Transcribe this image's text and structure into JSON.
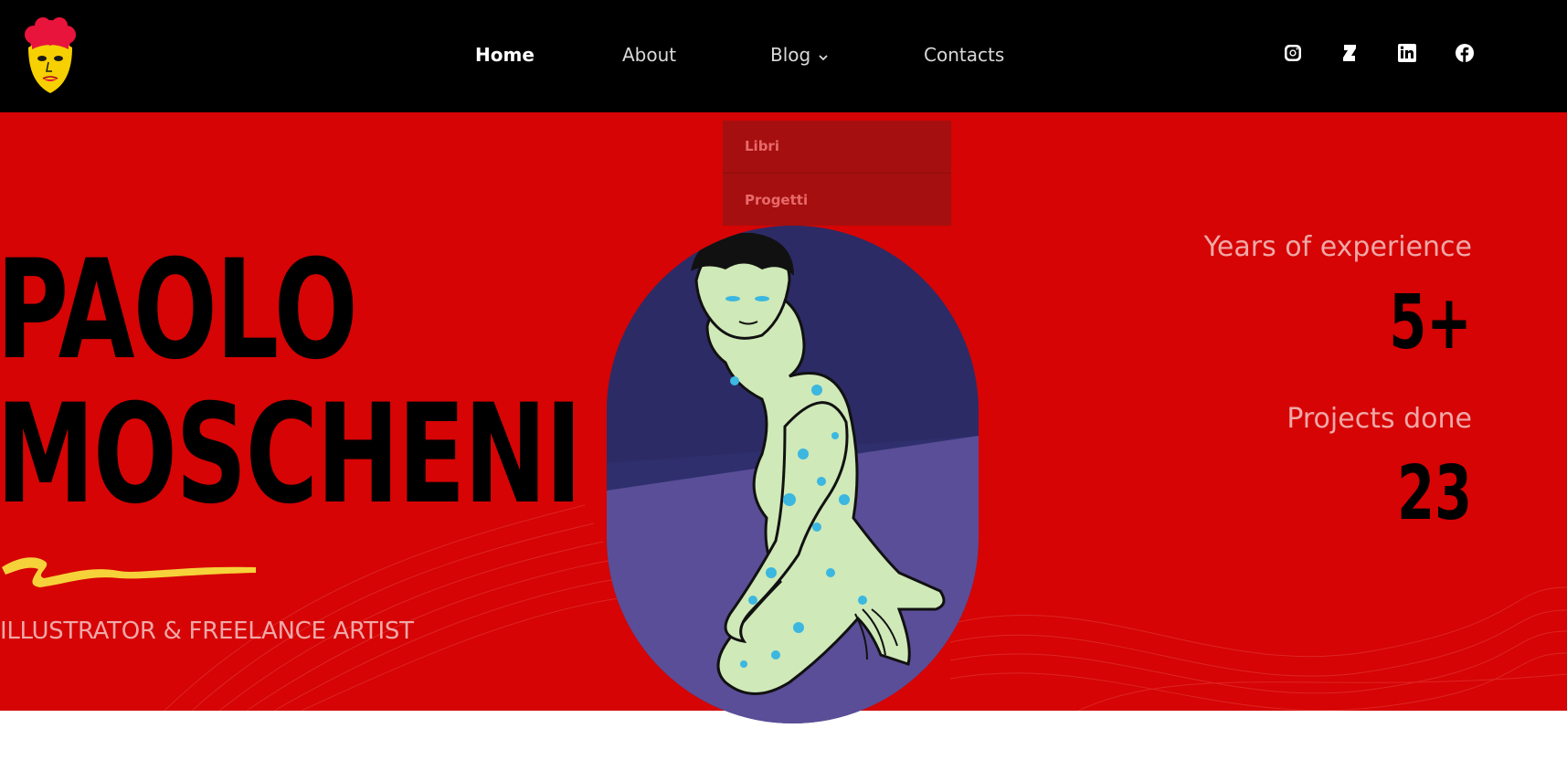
{
  "header": {
    "logo_icon": "artist-face-logo",
    "nav": [
      {
        "label": "Home",
        "active": true
      },
      {
        "label": "About",
        "active": false
      },
      {
        "label": "Blog",
        "active": false,
        "has_dropdown": true
      },
      {
        "label": "Contacts",
        "active": false
      }
    ],
    "social": [
      "instagram-icon",
      "deviantart-icon",
      "linkedin-icon",
      "facebook-icon"
    ]
  },
  "dropdown": {
    "items": [
      "Libri",
      "Progetti"
    ]
  },
  "hero": {
    "name_line_1": "PAOLO",
    "name_line_2": "MOSCHENI",
    "subtitle": "ILLUSTRATOR & FREELANCE ARTIST",
    "stats": [
      {
        "label": "Years of experience",
        "value": "5+"
      },
      {
        "label": "Projects done",
        "value": "23"
      }
    ]
  },
  "colors": {
    "header_bg": "#000000",
    "hero_bg": "#d60404",
    "dropdown_bg": "#a50f0f",
    "accent_yellow": "#f6d23a",
    "muted_pink": "#f0a8a8"
  }
}
